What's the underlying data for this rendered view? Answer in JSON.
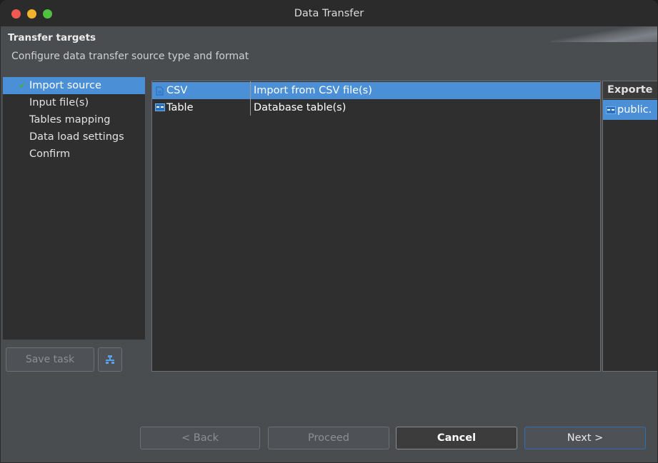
{
  "window": {
    "title": "Data Transfer"
  },
  "header": {
    "title": "Transfer targets",
    "description": "Configure data transfer source type and format"
  },
  "nav": {
    "items": [
      {
        "label": "Import source",
        "selected": true,
        "completed": true
      },
      {
        "label": "Input file(s)"
      },
      {
        "label": "Tables mapping"
      },
      {
        "label": "Data load settings"
      },
      {
        "label": "Confirm"
      }
    ]
  },
  "task": {
    "save_label": "Save task",
    "icon": "task-config-icon"
  },
  "sources": {
    "rows": [
      {
        "name": "CSV",
        "description": "Import from CSV file(s)",
        "icon": "csv-file-icon",
        "selected": true
      },
      {
        "name": "Table",
        "description": "Database table(s)",
        "icon": "table-icon"
      }
    ]
  },
  "export_panel": {
    "header": "Exporte",
    "items": [
      {
        "label": "public.",
        "icon": "table-icon"
      }
    ]
  },
  "buttons": {
    "back": "< Back",
    "proceed": "Proceed",
    "cancel": "Cancel",
    "next": "Next >"
  },
  "colors": {
    "selection": "#4b8fd6",
    "panel_bg": "#2f2f2f",
    "window_bg": "#4a4d50",
    "check": "#3fae3f"
  }
}
